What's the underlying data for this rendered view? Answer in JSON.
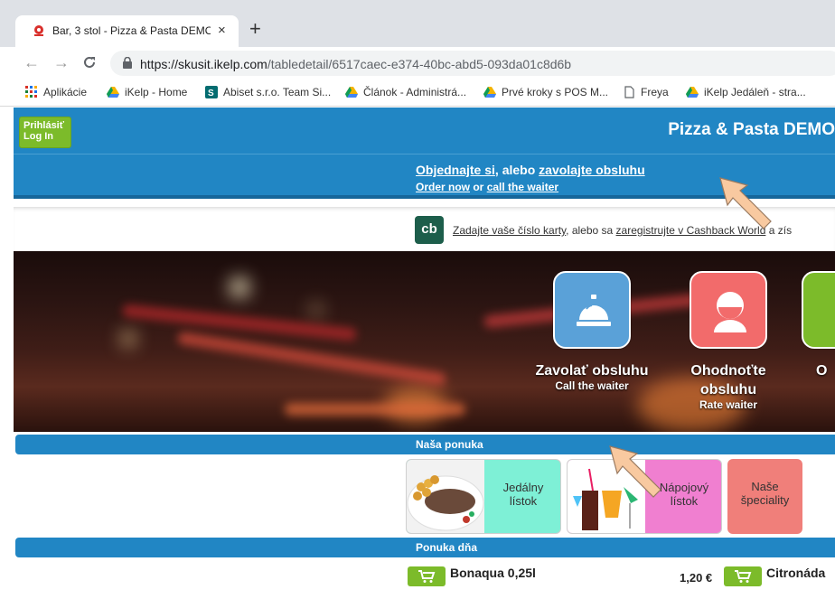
{
  "browser": {
    "tab_title": "Bar, 3 stol - Pizza & Pasta DEMO",
    "tab_close": "×",
    "new_tab": "+",
    "url_host": "https://skusit.ikelp.com",
    "url_path": "/tabledetail/6517caec-e374-40bc-abd5-093da01c8d6b",
    "nav": {
      "back": "←",
      "forward": "→",
      "reload": "C"
    },
    "bookmarks": [
      {
        "label": "Aplikácie",
        "icon": "apps-grid-icon"
      },
      {
        "label": "iKelp - Home",
        "icon": "drive-icon"
      },
      {
        "label": "Abiset s.r.o. Team Si...",
        "icon": "sharepoint-icon"
      },
      {
        "label": "Článok - Administrá...",
        "icon": "drive-icon"
      },
      {
        "label": "Prvé kroky s POS M...",
        "icon": "drive-icon"
      },
      {
        "label": "Freya",
        "icon": "page-icon"
      },
      {
        "label": "iKelp Jedáleň - stra...",
        "icon": "drive-icon"
      }
    ]
  },
  "header": {
    "login_label_1": "Prihlásiť",
    "login_label_2": "Log In",
    "restaurant_name": "Pizza & Pasta DEMO"
  },
  "order_bar": {
    "order_sk": "Objednajte si",
    "sep_sk": ", alebo ",
    "call_sk": "zavolajte obsluhu",
    "order_en": "Order now",
    "sep_en": " or ",
    "call_en": "call the waiter"
  },
  "cashback": {
    "logo": "cb",
    "link1": "Zadajte vaše číslo karty",
    "mid": ", alebo sa ",
    "link2": "zaregistrujte v Cashback World",
    "tail": " a zís"
  },
  "actions": [
    {
      "label": "Zavolať obsluhu",
      "sub": "Call the waiter",
      "color": "#5aa1d8"
    },
    {
      "label": "Ohodnoťte obsluhu",
      "sub": "Rate waiter",
      "color": "#f26b6b"
    },
    {
      "label": "O",
      "sub": "",
      "color": "#7cbb2a"
    }
  ],
  "sections": {
    "menu_title": "Naša ponuka",
    "daily_title": "Ponuka dňa"
  },
  "categories": [
    {
      "label": "Jedálny lístok",
      "color": "#7ef0d6"
    },
    {
      "label": "Nápojový lístok",
      "color": "#f07fd0"
    },
    {
      "label": "Naše špeciality",
      "color": "#f07f7a"
    }
  ],
  "daily_items": [
    {
      "name": "Bonaqua 0,25l",
      "price": "1,20 €"
    },
    {
      "name": "Citronáda",
      "price": ""
    }
  ],
  "colors": {
    "brand_blue": "#2186c4",
    "login_green": "#7cbb2a",
    "cb_green": "#1d5e4b"
  }
}
